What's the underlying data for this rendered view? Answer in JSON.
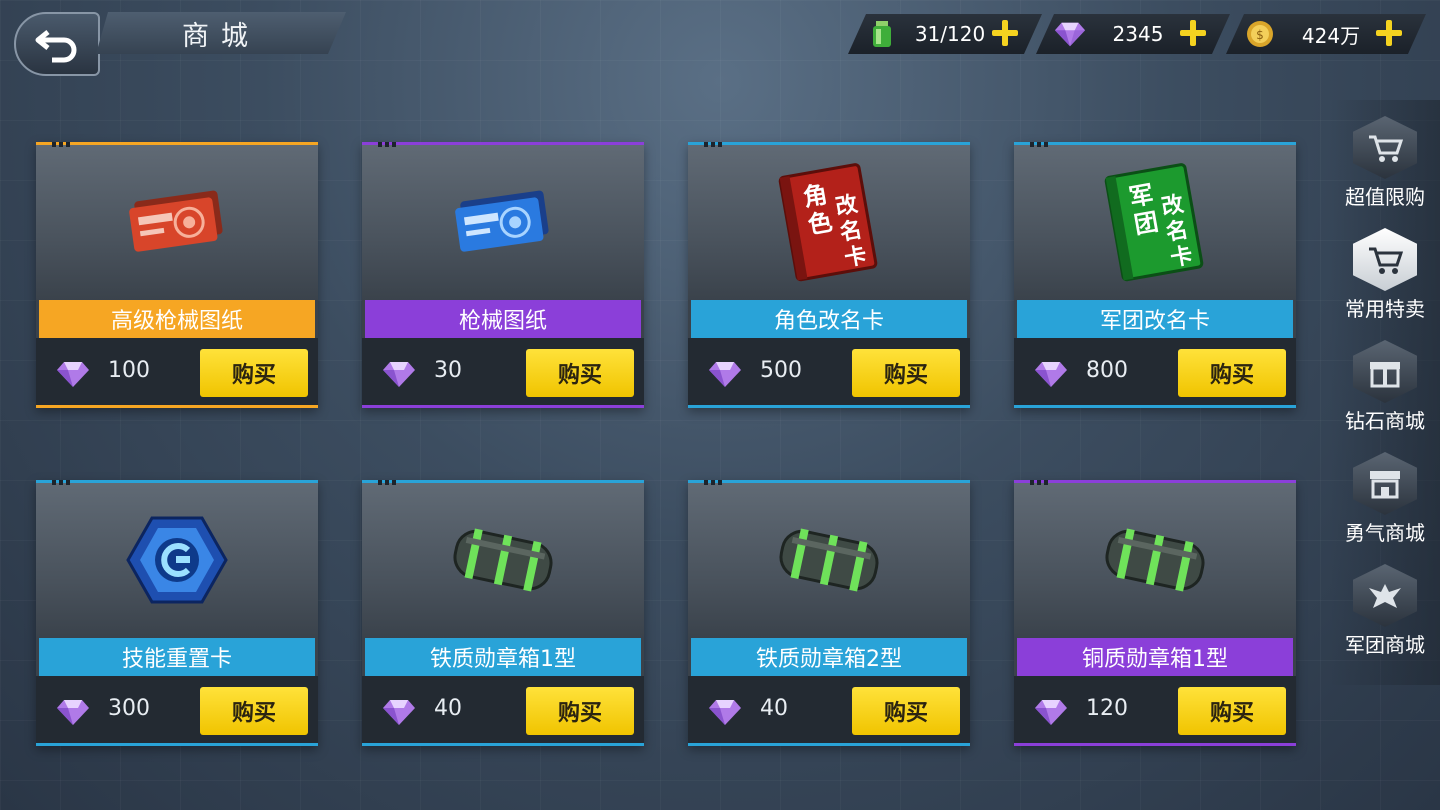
{
  "header": {
    "title": "商城"
  },
  "resources": [
    {
      "icon": "stamina-bottle-icon",
      "value": "31/120"
    },
    {
      "icon": "diamond-icon",
      "value": "2345"
    },
    {
      "icon": "gold-coin-icon",
      "value": "424万"
    }
  ],
  "items": [
    {
      "name": "高级枪械图纸",
      "price": "100",
      "buy": "购买",
      "color": "#f6a623",
      "art": "red-blueprint-ticket"
    },
    {
      "name": "枪械图纸",
      "price": "30",
      "buy": "购买",
      "color": "#8b3fd9",
      "art": "blue-blueprint-ticket"
    },
    {
      "name": "角色改名卡",
      "price": "500",
      "buy": "购买",
      "color": "#29a3d8",
      "art": "red-rename-card",
      "art_text": [
        "角",
        "色",
        "改",
        "名",
        "卡"
      ]
    },
    {
      "name": "军团改名卡",
      "price": "800",
      "buy": "购买",
      "color": "#29a3d8",
      "art": "green-rename-card",
      "art_text": [
        "军",
        "团",
        "改",
        "名",
        "卡"
      ]
    },
    {
      "name": "技能重置卡",
      "price": "300",
      "buy": "购买",
      "color": "#29a3d8",
      "art": "skill-reset-chip"
    },
    {
      "name": "铁质勋章箱1型",
      "price": "40",
      "buy": "购买",
      "color": "#29a3d8",
      "art": "medal-box"
    },
    {
      "name": "铁质勋章箱2型",
      "price": "40",
      "buy": "购买",
      "color": "#29a3d8",
      "art": "medal-box"
    },
    {
      "name": "铜质勋章箱1型",
      "price": "120",
      "buy": "购买",
      "color": "#8b3fd9",
      "art": "medal-box"
    }
  ],
  "sidebar": [
    {
      "label": "超值限购",
      "icon": "cart-icon"
    },
    {
      "label": "常用特卖",
      "icon": "cart-icon",
      "active": true
    },
    {
      "label": "钻石商城",
      "icon": "gift-box-icon"
    },
    {
      "label": "勇气商城",
      "icon": "shop-icon"
    },
    {
      "label": "军团商城",
      "icon": "eagle-emblem-icon"
    }
  ]
}
